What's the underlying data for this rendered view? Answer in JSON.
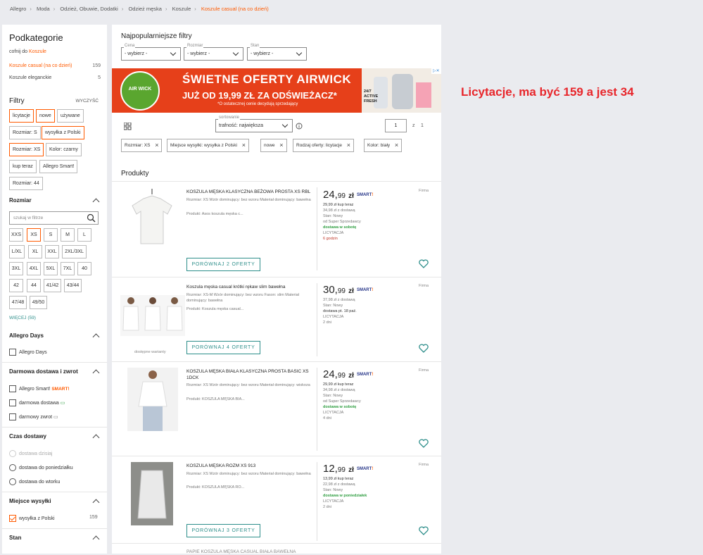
{
  "breadcrumb": [
    "Allegro",
    "Moda",
    "Odzież, Obuwie, Dodatki",
    "Odzież męska",
    "Koszule",
    "Koszule casual (na co dzień)"
  ],
  "sidebar": {
    "title": "Podkategorie",
    "back_prefix": "cofnij do ",
    "back_link": "Koszule",
    "subcats": [
      {
        "label": "Koszule casual (na co dzień)",
        "count": "159"
      },
      {
        "label": "Koszule eleganckie",
        "count": "5"
      }
    ],
    "filters_title": "Filtry",
    "clear_label": "WYCZYŚĆ",
    "active_chips": [
      "licytacje",
      "nowe",
      "używane",
      "Rozmiar: S",
      "wysyłka z Polski",
      "Rozmiar: XS",
      "Kolor: czarny",
      "kup teraz",
      "Allegro Smart!",
      "Rozmiar: 44"
    ],
    "size_title": "Rozmiar",
    "size_search_placeholder": "szukaj w filtrze",
    "sizes": [
      "XXS",
      "XS",
      "S",
      "M",
      "L",
      "L/XL",
      "XL",
      "XXL",
      "2XL/3XL",
      "3XL",
      "4XL",
      "5XL",
      "7XL",
      "40",
      "42",
      "44",
      "41/42",
      "43/44",
      "47/48",
      "49/50"
    ],
    "more_label": "WIĘCEJ (59)",
    "allegro_days_title": "Allegro Days",
    "allegro_days_option": "Allegro Days",
    "delivery_title": "Darmowa dostawa i zwrot",
    "delivery_options": [
      "Allegro Smart!",
      "darmowa dostawa",
      "darmowy zwrot"
    ],
    "smart_badge": "SMART",
    "time_title": "Czas dostawy",
    "time_options": [
      "dostawa dzisiaj",
      "dostawa do poniedziałku",
      "dostawa do wtorku"
    ],
    "ship_title": "Miejsce wysyłki",
    "ship_option": "wysyłka z Polski",
    "ship_count": "159",
    "state_title": "Stan"
  },
  "main": {
    "popular_title": "Najpopularniejsze filtry",
    "selects": [
      {
        "caption": "Cena",
        "value": "- wybierz -"
      },
      {
        "caption": "Rozmiar",
        "value": "- wybierz -"
      },
      {
        "caption": "Stan",
        "value": "- wybierz -"
      }
    ],
    "banner": {
      "headline": "ŚWIETNE OFERTY AIRWICK",
      "subline": "JUŻ OD 19,99 ZŁ ZA ODŚWIEŻACZ*",
      "footnote": "*O ostatecznej cenie decydują sprzedający",
      "logo": "AIR WICK",
      "product_text": "24/7 ACTIVE FRESH"
    },
    "sort_caption": "sortowanie",
    "sort_value": "trafność: największa",
    "page_value": "1",
    "page_of": "z",
    "page_total": "1",
    "applied_filters": [
      "Rozmiar: XS",
      "Miejsce wysyłki: wysyłka z Polski",
      "nowe",
      "Rodzaj oferty: licytacje",
      "Kolor: biały"
    ],
    "products_title": "Produkty",
    "products": [
      {
        "title": "KOSZULA MĘSKA KLASYCZNA BEŻOWA PROSTA XS RBL",
        "meta": "Rozmiar: XS   Wzór dominujący: bez wzoru   Materiał dominujący: bawełna",
        "desc": "Produkt: Asos koszula męska c...",
        "price_main": "24,",
        "price_cents": "99",
        "currency": "zł",
        "info": [
          "29,99 zł kup teraz",
          "34,98 zł z dostawą",
          "Stan: Nowy",
          "od Super Sprzedawcy",
          "dostawa w sobotę",
          "LICYTACJA",
          "6 godzin"
        ],
        "seller": "Firma",
        "compare": "PORÓWNAJ 2 OFERTY",
        "variants": ""
      },
      {
        "title": "Koszula męska casual krótki rękaw slim bawełna",
        "meta": "Rozmiar: XS-M   Wzór dominujący: bez wzoru   Fason: slim   Materiał dominujący: bawełna",
        "desc": "Produkt: Koszula męska casual...",
        "price_main": "30,",
        "price_cents": "99",
        "currency": "zł",
        "info": [
          "37,98 zł z dostawą",
          "Stan: Nowy",
          "dostawa pt. 18 paź.",
          "LICYTACJA",
          "2 dni"
        ],
        "seller": "Firma",
        "compare": "PORÓWNAJ 4 OFERTY",
        "variants": "dostępne warianty"
      },
      {
        "title": "KOSZULA MĘSKA BIAŁA KLASYCZNA PROSTA BASIC XS 1DCK",
        "meta": "Rozmiar: XS   Wzór dominujący: bez wzoru   Materiał dominujący: wiskoza",
        "desc": "Produkt: KOSZULA MĘSKA BIA...",
        "price_main": "24,",
        "price_cents": "99",
        "currency": "zł",
        "info": [
          "29,99 zł kup teraz",
          "34,98 zł z dostawą",
          "Stan: Nowy",
          "od Super Sprzedawcy",
          "dostawa w sobotę",
          "LICYTACJA",
          "4 dni"
        ],
        "seller": "Firma",
        "compare": "",
        "variants": ""
      },
      {
        "title": "KOSZULA MĘSKA ROZM XS 913",
        "meta": "Rozmiar: XS   Wzór dominujący: bez wzoru   Materiał dominujący: bawełna",
        "desc": "Produkt: KOSZULA MĘSKA RO...",
        "price_main": "12,",
        "price_cents": "99",
        "currency": "zł",
        "info": [
          "13,99 zł kup teraz",
          "22,98 zł z dostawą",
          "Stan: Nowy",
          "dostawa w poniedziałek",
          "LICYTACJA",
          "2 dni"
        ],
        "seller": "Firma",
        "compare": "PORÓWNAJ 3 OFERTY",
        "variants": ""
      }
    ],
    "next_title_partial": "PAPIE KOSZULA MĘSKA CASUAL BIAŁA BAWEŁNA"
  },
  "annotation": "Licytacje, ma być 159 a jest 34"
}
